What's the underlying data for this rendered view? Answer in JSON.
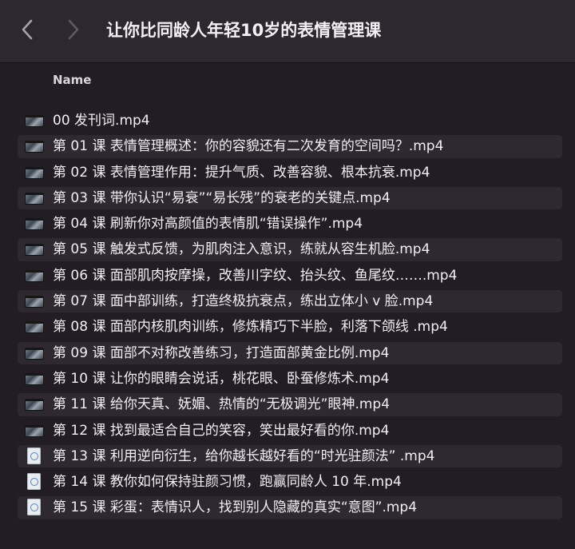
{
  "window": {
    "title": "让你比同龄人年轻10岁的表情管理课"
  },
  "toolbar": {
    "back_icon": "chevron-left-icon",
    "forward_icon": "chevron-right-icon"
  },
  "columns": {
    "name": "Name"
  },
  "files": [
    {
      "name": "00 发刊词.mp4",
      "icon": "video-file-icon"
    },
    {
      "name": "第 01 课 表情管理概述：你的容貌还有二次发育的空间吗？.mp4",
      "icon": "video-file-icon"
    },
    {
      "name": "第 02 课 表情管理作用：提升气质、改善容貌、根本抗衰.mp4",
      "icon": "video-file-icon"
    },
    {
      "name": "第 03 课 带你认识“易衰”“易长残”的衰老的关键点.mp4",
      "icon": "video-file-icon"
    },
    {
      "name": "第 04 课 刷新你对高颜值的表情肌“错误操作”.mp4",
      "icon": "video-file-icon"
    },
    {
      "name": "第 05 课 触发式反馈，为肌肉注入意识，练就从容生机脸.mp4",
      "icon": "video-file-icon"
    },
    {
      "name": "第 06 课 面部肌肉按摩操，改善川字纹、抬头纹、鱼尾纹…….mp4",
      "icon": "video-file-icon"
    },
    {
      "name": "第 07 课 面中部训练，打造终极抗衰点，练出立体小 v 脸.mp4",
      "icon": "video-file-icon"
    },
    {
      "name": "第 08 课 面部内核肌肉训练，修炼精巧下半脸，利落下颌线 .mp4",
      "icon": "video-file-icon"
    },
    {
      "name": "第 09 课 面部不对称改善练习，打造面部黄金比例.mp4",
      "icon": "video-file-icon"
    },
    {
      "name": "第 10 课 让你的眼睛会说话，桃花眼、卧蚕修炼术.mp4",
      "icon": "video-file-icon"
    },
    {
      "name": "第 11 课 给你天真、妩媚、热情的“无极调光”眼神.mp4",
      "icon": "video-file-icon"
    },
    {
      "name": "第 12 课 找到最适合自己的笑容，笑出最好看的你.mp4",
      "icon": "video-file-icon"
    },
    {
      "name": "第 13 课 利用逆向衍生，给你越长越好看的“时光驻颜法” .mp4",
      "icon": "document-file-icon"
    },
    {
      "name": "第 14 课 教你如何保持驻颜习惯，跑赢同龄人 10 年.mp4",
      "icon": "document-file-icon"
    },
    {
      "name": "第 15 课 彩蛋：表情识人，找到别人隐藏的真实“意图”.mp4",
      "icon": "document-file-icon"
    }
  ],
  "colors": {
    "background": "#221d24",
    "titlebar": "#2d282f",
    "row_stripe": "#2e2931",
    "text": "#f1eff2"
  }
}
